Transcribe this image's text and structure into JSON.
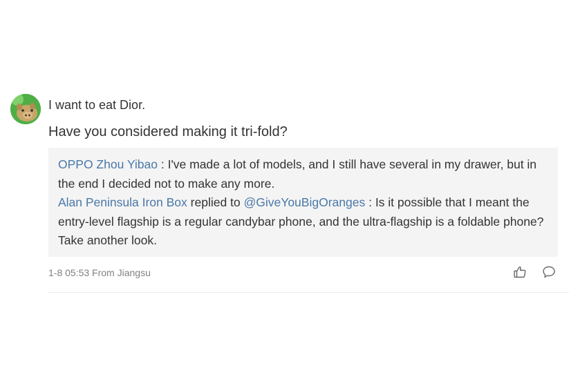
{
  "comment": {
    "username": "I want to eat Dior.",
    "text": "Have you considered making it tri-fold?",
    "avatar_icon": "pig-avatar-icon",
    "replies": [
      {
        "author": "OPPO Zhou Yibao",
        "separator": " : ",
        "text": "I've made a lot of models, and I still have several in my drawer, but in the end I decided not to make any more."
      },
      {
        "author": "Alan Peninsula Iron Box",
        "replied_to_label": " replied to ",
        "mention": "@GiveYouBigOranges",
        "separator": " : ",
        "text": "Is it possible that I meant the entry-level flagship is a regular candybar phone, and the ultra-flagship is a foldable phone? Take another look."
      }
    ],
    "timestamp": "1-8 05:53 From Jiangsu",
    "icons": {
      "like": "thumbs-up-icon",
      "reply": "speech-bubble-icon"
    }
  },
  "colors": {
    "link": "#4a78a8",
    "text": "#333333",
    "meta": "#808080",
    "reply_bg": "#f4f4f4"
  }
}
